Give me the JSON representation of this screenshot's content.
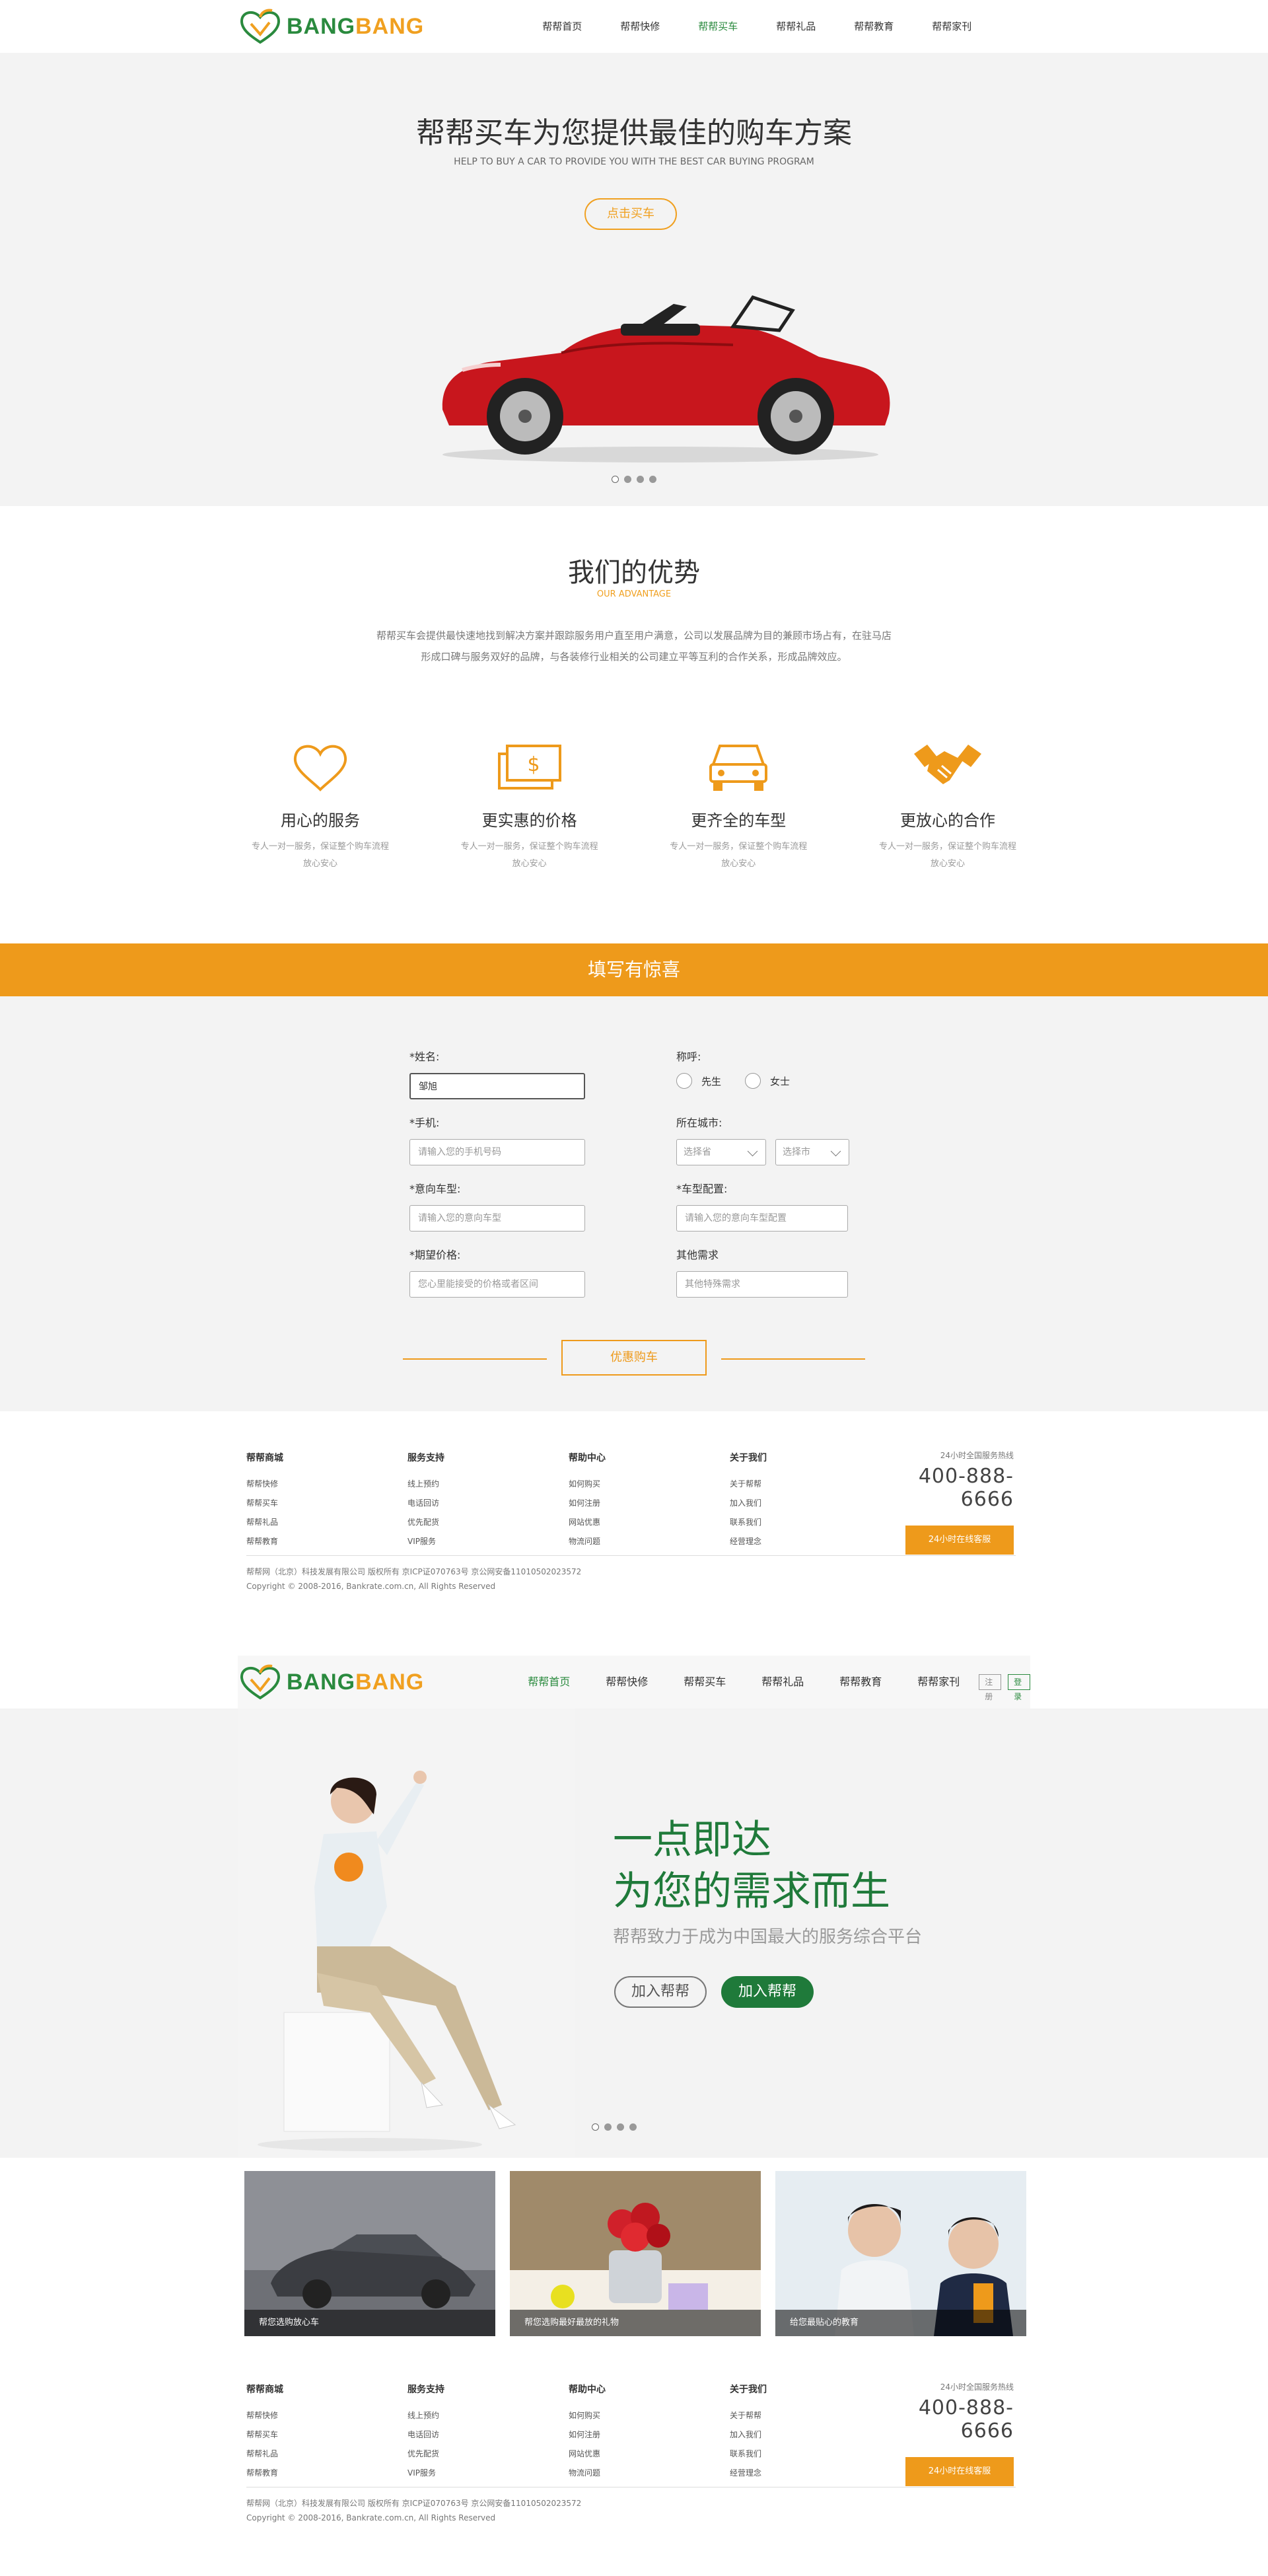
{
  "page1": {
    "logo": {
      "brand_green": "BANG",
      "brand_orange": "BANG"
    },
    "nav": [
      "帮帮首页",
      "帮帮快修",
      "帮帮买车",
      "帮帮礼品",
      "帮帮教育",
      "帮帮家刊"
    ],
    "nav_active_index": 2,
    "hero": {
      "title": "帮帮买车为您提供最佳的购车方案",
      "subtitle": "HELP TO BUY A CAR TO PROVIDE YOU WITH THE BEST CAR BUYING PROGRAM",
      "button": "点击买车",
      "slides": 4,
      "active_slide": 1
    },
    "advantage": {
      "title": "我们的优势",
      "subtitle": "OUR ADVANTAGE",
      "desc_line1": "帮帮买车会提供最快速地找到解决方案并跟踪服务用户直至用户满意，公司以发展品牌为目的兼顾市场占有，在驻马店",
      "desc_line2": "形成口碑与服务双好的品牌，与各装修行业相关的公司建立平等互利的合作关系，形成品牌效应。",
      "items": [
        {
          "icon": "heart-icon",
          "title": "用心的服务",
          "line1": "专人一对一服务，保证整个购车流程",
          "line2": "放心安心"
        },
        {
          "icon": "money-icon",
          "title": "更实惠的价格",
          "line1": "专人一对一服务，保证整个购车流程",
          "line2": "放心安心"
        },
        {
          "icon": "car-front-icon",
          "title": "更齐全的车型",
          "line1": "专人一对一服务，保证整个购车流程",
          "line2": "放心安心"
        },
        {
          "icon": "handshake-icon",
          "title": "更放心的合作",
          "line1": "专人一对一服务，保证整个购车流程",
          "line2": "放心安心"
        }
      ]
    },
    "form": {
      "banner": "填写有惊喜",
      "name_label": "*姓名:",
      "name_value": "邹旭",
      "title_label": "称呼:",
      "title_options": [
        "先生",
        "女士"
      ],
      "phone_label": "*手机:",
      "phone_placeholder": "请输入您的手机号码",
      "city_label": "所在城市:",
      "province_placeholder": "选择省",
      "city_placeholder": "选择市",
      "model_label": "*意向车型:",
      "model_placeholder": "请输入您的意向车型",
      "config_label": "*车型配置:",
      "config_placeholder": "请输入您的意向车型配置",
      "price_label": "*期望价格:",
      "price_placeholder": "您心里能接受的价格或者区间",
      "other_label": "其他需求",
      "other_placeholder": "其他特殊需求",
      "submit": "优惠购车"
    }
  },
  "footer": {
    "columns": [
      {
        "title": "帮帮商城",
        "links": [
          "帮帮快修",
          "帮帮买车",
          "帮帮礼品",
          "帮帮教育"
        ]
      },
      {
        "title": "服务支持",
        "links": [
          "线上预约",
          "电话回访",
          "优先配货",
          "VIP服务"
        ]
      },
      {
        "title": "帮助中心",
        "links": [
          "如何购买",
          "如何注册",
          "网站优惠",
          "物流问题"
        ]
      },
      {
        "title": "关于我们",
        "links": [
          "关于帮帮",
          "加入我们",
          "联系我们",
          "经营理念"
        ]
      }
    ],
    "hotline_label": "24小时全国服务热线",
    "hotline": "400-888-6666",
    "online_button": "24小时在线客服",
    "copy1": "帮帮网（北京）科技发展有限公司 版权所有 京ICP证070763号 京公网安备11010502023572",
    "copy2": "Copyright © 2008-2016, Bankrate.com.cn, All Rights Reserved"
  },
  "page2": {
    "nav": [
      "帮帮首页",
      "帮帮快修",
      "帮帮买车",
      "帮帮礼品",
      "帮帮教育",
      "帮帮家刊"
    ],
    "nav_active_index": 0,
    "register": "注册",
    "login": "登录",
    "hero": {
      "line1": "一点即达",
      "line2": "为您的需求而生",
      "sub": "帮帮致力于成为中国最大的服务综合平台",
      "btn_join": "加入帮帮",
      "btn_join2": "加入帮帮",
      "slides": 4,
      "active_slide": 1
    },
    "cards": [
      {
        "caption": "帮您选购放心车",
        "image": "sedan-car"
      },
      {
        "caption": "帮您选购最好最放的礼物",
        "image": "flowers-gift"
      },
      {
        "caption": "给您最贴心的教育",
        "image": "students-study"
      }
    ]
  },
  "colors": {
    "green": "#2a8a3e",
    "orange": "#ee9a1b",
    "hero_bg": "#f3f3f3"
  }
}
